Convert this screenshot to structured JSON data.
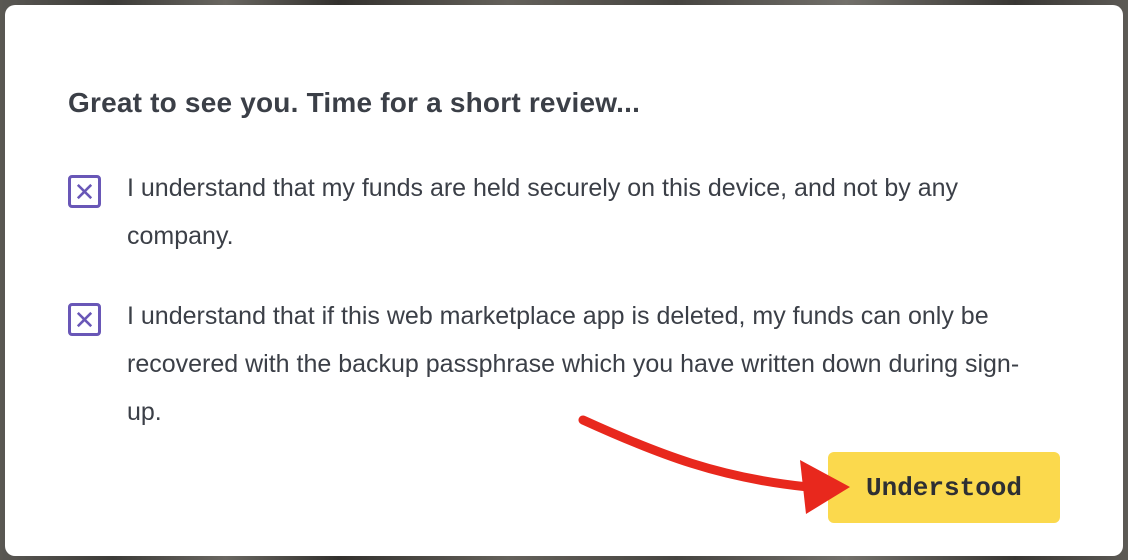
{
  "modal": {
    "title": "Great to see you. Time for a short review...",
    "items": [
      {
        "checked": true,
        "text": "I understand that my funds are held securely on this device, and not by any company."
      },
      {
        "checked": true,
        "text": "I understand that if this web marketplace app is deleted, my funds can only be recovered with the backup passphrase which you have written down during sign-up."
      }
    ],
    "checkbox_icon": "x-mark-icon",
    "button_label": "Understood"
  },
  "colors": {
    "accent": "#6957b7",
    "button": "#fbd94d",
    "annotation_arrow": "#e8281d",
    "text": "#3b3f47"
  }
}
